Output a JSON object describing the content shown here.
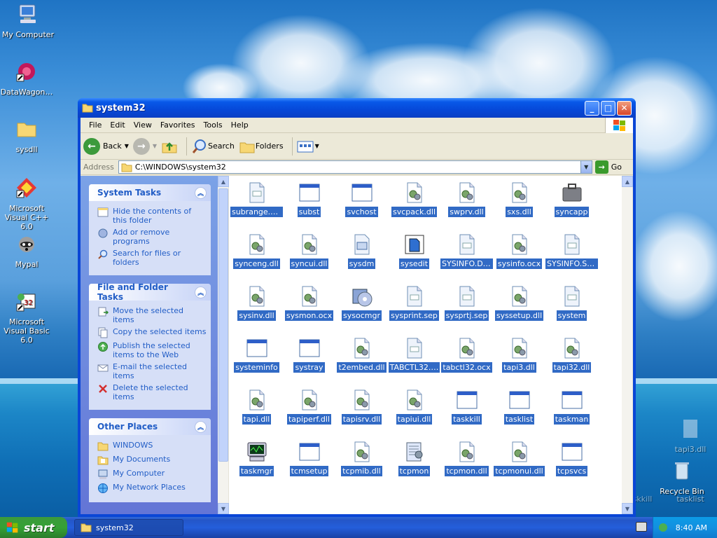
{
  "desktop": {
    "icons": [
      {
        "label": "My Computer"
      },
      {
        "label": "DataWagon…"
      },
      {
        "label": "sysdll"
      },
      {
        "label": "Microsoft Visual C++ 6.0"
      },
      {
        "label": "Mypal"
      },
      {
        "label": "Microsoft Visual Basic 6.0"
      }
    ],
    "ghost_icons": [
      {
        "label": "tapi3.dll"
      },
      {
        "label": "Recycle Bin"
      },
      {
        "label": "tasklist"
      },
      {
        "label": "taskkill"
      }
    ]
  },
  "window": {
    "title": "system32",
    "menu": [
      "File",
      "Edit",
      "View",
      "Favorites",
      "Tools",
      "Help"
    ],
    "toolbar": {
      "back": "Back",
      "search": "Search",
      "folders": "Folders"
    },
    "address": {
      "label": "Address",
      "value": "C:\\WINDOWS\\system32",
      "go": "Go"
    }
  },
  "task_panes": [
    {
      "title": "System Tasks",
      "links": [
        "Hide the contents of this folder",
        "Add or remove programs",
        "Search for files or folders"
      ]
    },
    {
      "title": "File and Folder Tasks",
      "links": [
        "Move the selected items",
        "Copy the selected items",
        "Publish the selected items to the Web",
        "E-mail the selected items",
        "Delete the selected items"
      ]
    },
    {
      "title": "Other Places",
      "links": [
        "WINDOWS",
        "My Documents",
        "My Computer",
        "My Network Places"
      ]
    }
  ],
  "files": [
    {
      "name": "subrange.uce",
      "icon": "file"
    },
    {
      "name": "subst",
      "icon": "exe"
    },
    {
      "name": "svchost",
      "icon": "exe"
    },
    {
      "name": "svcpack.dll",
      "icon": "dll"
    },
    {
      "name": "swprv.dll",
      "icon": "dll"
    },
    {
      "name": "sxs.dll",
      "icon": "dll"
    },
    {
      "name": "syncapp",
      "icon": "briefcase"
    },
    {
      "name": "synceng.dll",
      "icon": "dll"
    },
    {
      "name": "syncui.dll",
      "icon": "dll"
    },
    {
      "name": "sysdm",
      "icon": "cpl"
    },
    {
      "name": "sysedit",
      "icon": "sysedit"
    },
    {
      "name": "SYSINFO.DEP",
      "icon": "file"
    },
    {
      "name": "sysinfo.ocx",
      "icon": "dll"
    },
    {
      "name": "SYSINFO.SRG",
      "icon": "file"
    },
    {
      "name": "sysinv.dll",
      "icon": "dll"
    },
    {
      "name": "sysmon.ocx",
      "icon": "dll"
    },
    {
      "name": "sysocmgr",
      "icon": "cd"
    },
    {
      "name": "sysprint.sep",
      "icon": "file"
    },
    {
      "name": "sysprtj.sep",
      "icon": "file"
    },
    {
      "name": "syssetup.dll",
      "icon": "dll"
    },
    {
      "name": "system",
      "icon": "file"
    },
    {
      "name": "systeminfo",
      "icon": "exe"
    },
    {
      "name": "systray",
      "icon": "exe"
    },
    {
      "name": "t2embed.dll",
      "icon": "dll"
    },
    {
      "name": "TABCTL32.…",
      "icon": "file"
    },
    {
      "name": "tabctl32.ocx",
      "icon": "dll"
    },
    {
      "name": "tapi3.dll",
      "icon": "dll"
    },
    {
      "name": "tapi32.dll",
      "icon": "dll"
    },
    {
      "name": "tapi.dll",
      "icon": "dll"
    },
    {
      "name": "tapiperf.dll",
      "icon": "dll"
    },
    {
      "name": "tapisrv.dll",
      "icon": "dll"
    },
    {
      "name": "tapiui.dll",
      "icon": "dll"
    },
    {
      "name": "taskkill",
      "icon": "exe"
    },
    {
      "name": "tasklist",
      "icon": "exe"
    },
    {
      "name": "taskman",
      "icon": "exe"
    },
    {
      "name": "taskmgr",
      "icon": "monitor"
    },
    {
      "name": "tcmsetup",
      "icon": "exe"
    },
    {
      "name": "tcpmib.dll",
      "icon": "dll"
    },
    {
      "name": "tcpmon",
      "icon": "notepad"
    },
    {
      "name": "tcpmon.dll",
      "icon": "dll"
    },
    {
      "name": "tcpmonui.dll",
      "icon": "dll"
    },
    {
      "name": "tcpsvcs",
      "icon": "exe"
    }
  ],
  "taskbar": {
    "start": "start",
    "active_task": "system32",
    "clock": "8:40 AM"
  }
}
